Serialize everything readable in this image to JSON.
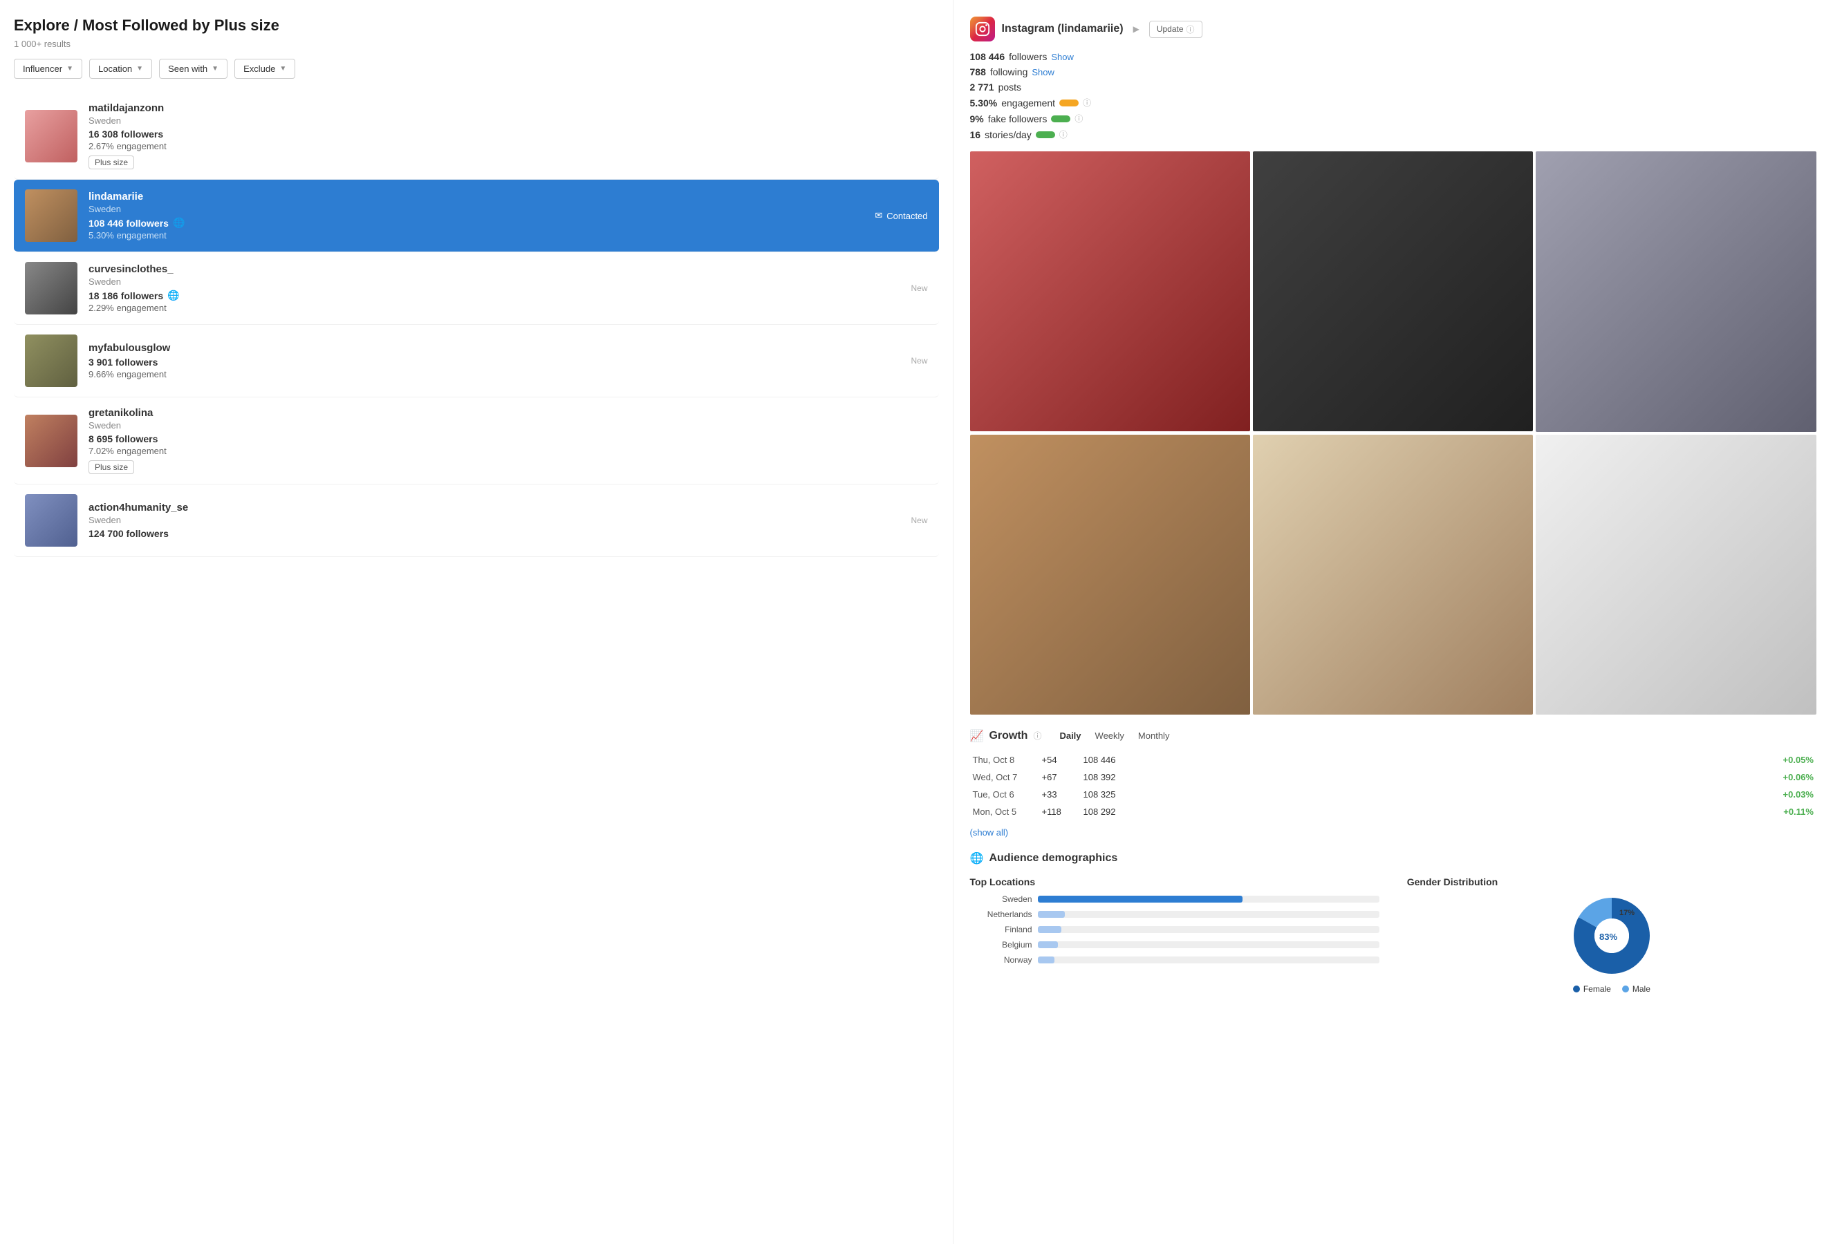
{
  "page": {
    "title": "Explore / Most Followed by Plus size",
    "results_count": "1 000+ results"
  },
  "filters": [
    {
      "label": "Influencer",
      "id": "influencer-filter"
    },
    {
      "label": "Location",
      "id": "location-filter"
    },
    {
      "label": "Seen with",
      "id": "seen-with-filter"
    },
    {
      "label": "Exclude",
      "id": "exclude-filter"
    }
  ],
  "influencers": [
    {
      "id": "matildajanzonn",
      "name": "matildajanzonn",
      "country": "Sweden",
      "followers": "16 308 followers",
      "engagement": "2.67% engagement",
      "tag": "Plus size",
      "new": false,
      "selected": false,
      "has_globe": false,
      "avatar_class": "avatar-block-pink"
    },
    {
      "id": "lindamariie",
      "name": "lindamariie",
      "country": "Sweden",
      "followers": "108 446 followers",
      "engagement": "5.30% engagement",
      "tag": null,
      "new": false,
      "selected": true,
      "has_globe": true,
      "contacted": true,
      "avatar_class": "avatar-block-brown"
    },
    {
      "id": "curvesinclothes_",
      "name": "curvesinclothes_",
      "country": "Sweden",
      "followers": "18 186 followers",
      "engagement": "2.29% engagement",
      "tag": null,
      "new": true,
      "selected": false,
      "has_globe": true,
      "avatar_class": "avatar-block-dark"
    },
    {
      "id": "myfabulousglow",
      "name": "myfabulousglow",
      "country": null,
      "followers": "3 901 followers",
      "engagement": "9.66% engagement",
      "tag": null,
      "new": true,
      "selected": false,
      "has_globe": false,
      "avatar_class": "avatar-block-olive"
    },
    {
      "id": "gretanikolina",
      "name": "gretanikolina",
      "country": "Sweden",
      "followers": "8 695 followers",
      "engagement": "7.02% engagement",
      "tag": "Plus size",
      "new": false,
      "selected": false,
      "has_globe": false,
      "avatar_class": "avatar-block-warm"
    },
    {
      "id": "action4humanity_se",
      "name": "action4humanity_se",
      "country": "Sweden",
      "followers": "124 700 followers",
      "engagement": "",
      "tag": null,
      "new": true,
      "selected": false,
      "has_globe": false,
      "avatar_class": "avatar-block-blue"
    }
  ],
  "profile": {
    "platform": "Instagram",
    "username": "lindamariie",
    "update_label": "Update",
    "followers": "108 446",
    "followers_label": "followers",
    "show_followers": "Show",
    "following": "788",
    "following_label": "following",
    "show_following": "Show",
    "posts": "2 771",
    "posts_label": "posts",
    "engagement_pct": "5.30%",
    "engagement_label": "engagement",
    "fake_followers_pct": "9%",
    "fake_followers_label": "fake followers",
    "stories_per_day": "16",
    "stories_label": "stories/day"
  },
  "growth": {
    "title": "Growth",
    "periods": [
      "Daily",
      "Weekly",
      "Monthly"
    ],
    "active_period": "Daily",
    "rows": [
      {
        "day": "Thu, Oct 8",
        "delta": "+54",
        "total": "108 446",
        "pct": "+0.05%"
      },
      {
        "day": "Wed, Oct 7",
        "delta": "+67",
        "total": "108 392",
        "pct": "+0.06%"
      },
      {
        "day": "Tue, Oct 6",
        "delta": "+33",
        "total": "108 325",
        "pct": "+0.03%"
      },
      {
        "day": "Mon, Oct 5",
        "delta": "+118",
        "total": "108 292",
        "pct": "+0.11%"
      }
    ],
    "show_all": "(show all)"
  },
  "demographics": {
    "title": "Audience demographics",
    "locations_title": "Top Locations",
    "locations": [
      {
        "name": "Sweden",
        "pct": 60,
        "type": "primary"
      },
      {
        "name": "Netherlands",
        "pct": 8,
        "type": "thin"
      },
      {
        "name": "Finland",
        "pct": 7,
        "type": "thin"
      },
      {
        "name": "Belgium",
        "pct": 6,
        "type": "thin"
      },
      {
        "name": "Norway",
        "pct": 5,
        "type": "thin"
      }
    ],
    "gender_title": "Gender Distribution",
    "female_pct": "83%",
    "male_pct": "17%",
    "female_label": "Female",
    "male_label": "Male"
  },
  "photos": [
    {
      "class": "photo1"
    },
    {
      "class": "photo2"
    },
    {
      "class": "photo3"
    },
    {
      "class": "photo4"
    },
    {
      "class": "photo5"
    },
    {
      "class": "photo6"
    }
  ]
}
